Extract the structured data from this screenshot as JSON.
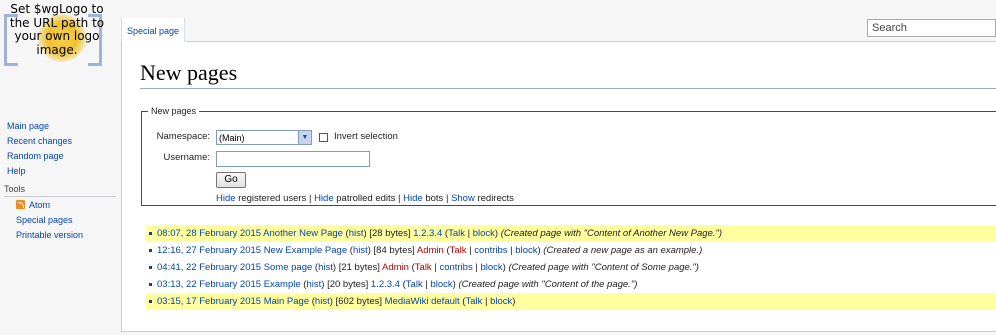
{
  "logo": {
    "text": "Set $wgLogo to the URL path to your own logo image."
  },
  "search": {
    "placeholder": "Search"
  },
  "tab": {
    "label": "Special page"
  },
  "navigation": {
    "items": [
      {
        "label": "Main page"
      },
      {
        "label": "Recent changes"
      },
      {
        "label": "Random page"
      },
      {
        "label": "Help"
      }
    ]
  },
  "tools": {
    "heading": "Tools",
    "items": [
      {
        "label": "Atom",
        "icon": "atom-feed-icon"
      },
      {
        "label": "Special pages"
      },
      {
        "label": "Printable version"
      }
    ]
  },
  "page": {
    "title": "New pages"
  },
  "form": {
    "legend": "New pages",
    "namespace_label": "Namespace:",
    "namespace_value": "(Main)",
    "invert_label": "Invert selection",
    "invert_checked": false,
    "username_label": "Username:",
    "username_value": "",
    "go_label": "Go",
    "filters": {
      "hide1": "Hide",
      "text1": "registered users",
      "sep1": "|",
      "hide2": "Hide",
      "text2": "patrolled edits",
      "sep2": "|",
      "hide3": "Hide",
      "text3": "bots",
      "sep3": "|",
      "show4": "Show",
      "text4": "redirects"
    }
  },
  "results": [
    {
      "time": "08:07, 28 February 2015",
      "page": "Another New Page",
      "hist": "hist",
      "size": "[28 bytes]",
      "user": "1.2.3.4",
      "talk": "Talk",
      "extra": "block",
      "comment": "(Created page with \"Content of Another New Page.\")"
    },
    {
      "time": "12:16, 27 February 2015",
      "page": "New Example Page",
      "hist": "hist",
      "size": "[84 bytes]",
      "user": "Admin",
      "talk": "Talk",
      "contribs": "contribs",
      "extra": "block",
      "comment": "(Created a new page as an example.)"
    },
    {
      "time": "04:41, 22 February 2015",
      "page": "Some page",
      "hist": "hist",
      "size": "[21 bytes]",
      "user": "Admin",
      "talk": "Talk",
      "contribs": "contribs",
      "extra": "block",
      "comment": "(Created page with \"Content of Some page.\")"
    },
    {
      "time": "03:13, 22 February 2015",
      "page": "Example",
      "hist": "hist",
      "size": "[20 bytes]",
      "user": "1.2.3.4",
      "talk": "Talk",
      "extra": "block",
      "comment": "(Created page with \"Content of the page.\")"
    },
    {
      "time": "03:15, 17 February 2015",
      "page": "Main Page",
      "hist": "hist",
      "size": "[602 bytes]",
      "user": "MediaWiki default",
      "talk": "Talk",
      "extra": "block",
      "comment": ""
    }
  ],
  "colors": {
    "link": "#0645ad",
    "redlink": "#ba0000",
    "highlight": "#ffffa0",
    "border": "#a7d7f9"
  }
}
